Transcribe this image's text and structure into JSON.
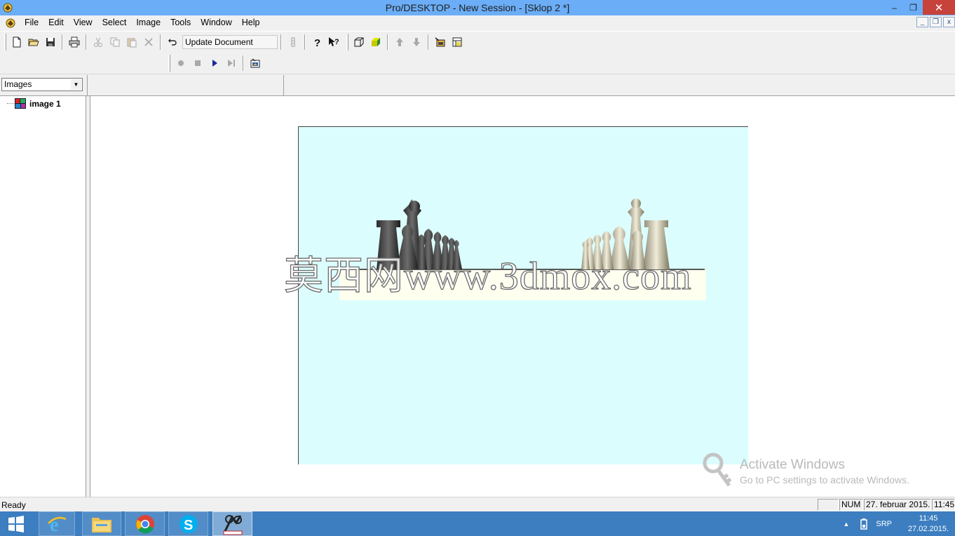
{
  "window": {
    "title": "Pro/DESKTOP - New Session - [Sklop 2 *]",
    "minimize_glyph": "–",
    "maximize_glyph": "❐",
    "close_glyph": "✕"
  },
  "menu": {
    "items": [
      "File",
      "Edit",
      "View",
      "Select",
      "Image",
      "Tools",
      "Window",
      "Help"
    ]
  },
  "mdi": {
    "minimize_glyph": "_",
    "restore_glyph": "❐",
    "close_glyph": "x"
  },
  "toolbar": {
    "update_document_label": "Update Document",
    "icons": [
      "new-icon",
      "open-icon",
      "save-icon",
      "print-icon",
      "cut-icon",
      "copy-icon",
      "paste-icon",
      "delete-icon",
      "undo-icon",
      "help-icon",
      "context-help-icon",
      "wireframe-icon",
      "shaded-icon",
      "up-icon",
      "down-icon"
    ]
  },
  "toolbar2": {
    "icons": [
      "record-icon",
      "stop-icon",
      "play-icon",
      "step-icon",
      "render-icon"
    ]
  },
  "panel": {
    "selector_value": "Images",
    "tree_items": [
      {
        "label": "image 1"
      }
    ]
  },
  "canvas": {
    "watermark": "莫西网www.3dmox.com",
    "activate_title": "Activate Windows",
    "activate_subtitle": "Go to PC settings to activate Windows."
  },
  "statusbar": {
    "ready": "Ready",
    "num": "NUM",
    "date": "27. februar 2015.",
    "time": "11:45"
  },
  "taskbar": {
    "apps": [
      "windows-start",
      "internet-explorer",
      "file-explorer",
      "chrome",
      "skype",
      "pro-desktop"
    ],
    "lang": "SRP",
    "clock_time": "11:45",
    "clock_date": "27.02.2015."
  },
  "colors": {
    "titlebar": "#6badf6",
    "viewport_bg": "#dbfdfd",
    "board": "#fffff0",
    "taskbar": "#3c7ec0",
    "close_button": "#c7423b"
  }
}
